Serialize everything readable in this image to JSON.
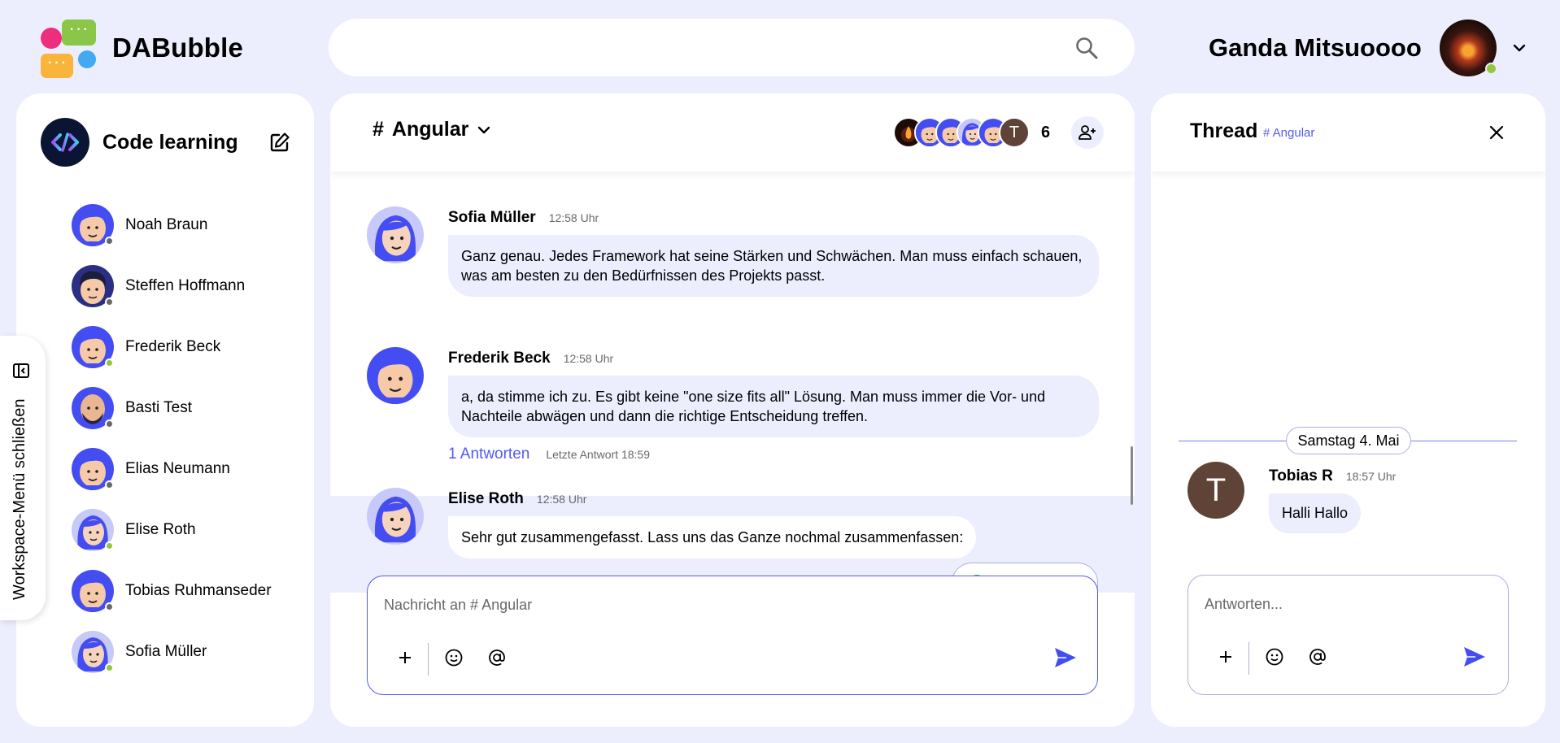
{
  "app": {
    "name": "DABubble"
  },
  "search": {
    "placeholder": ""
  },
  "user": {
    "name": "Ganda Mitsuoooo",
    "status_color": "#92c83e"
  },
  "workspace": {
    "name": "Code learning",
    "toggle_label": "Workspace-Menü schließen",
    "direct_messages": [
      {
        "name": "Noah Braun",
        "online": false
      },
      {
        "name": "Steffen Hoffmann",
        "online": false
      },
      {
        "name": "Frederik Beck",
        "online": true
      },
      {
        "name": "Basti Test",
        "online": false
      },
      {
        "name": "Elias Neumann",
        "online": false
      },
      {
        "name": "Elise Roth",
        "online": true
      },
      {
        "name": "Tobias Ruhmanseder",
        "online": false
      },
      {
        "name": "Sofia Müller",
        "online": true
      }
    ]
  },
  "channel": {
    "hash": "#",
    "name": "Angular",
    "member_count": "6",
    "member_initial": "T"
  },
  "messages": [
    {
      "author": "Sofia Müller",
      "time": "12:58 Uhr",
      "text": "Ganz genau. Jedes Framework hat seine Stärken und Schwächen. Man muss einfach schauen, was am besten zu den Bedürfnissen des Projekts passt."
    },
    {
      "author": "Frederik Beck",
      "time": "12:58 Uhr",
      "text": "a, da stimme ich zu. Es gibt keine \"one size fits all\" Lösung. Man muss immer die Vor- und Nachteile abwägen und dann die richtige Entscheidung treffen.",
      "replies": "1 Antworten",
      "last_reply": "Letzte Antwort 18:59"
    },
    {
      "author": "Elise Roth",
      "time": "12:58 Uhr",
      "text": "Sehr gut zusammengefasst. Lass uns das Ganze nochmal zusammenfassen:"
    }
  ],
  "composer": {
    "placeholder": "Nachricht an # Angular"
  },
  "thread": {
    "title": "Thread",
    "channel": "# Angular",
    "date": "Samstag 4. Mai",
    "message": {
      "initial": "T",
      "author": "Tobias R",
      "time": "18:57 Uhr",
      "text": "Halli Hallo"
    },
    "placeholder": "Antworten..."
  },
  "colors": {
    "accent": "#535af1",
    "background": "#eceefe",
    "online": "#92c83e",
    "offline": "#686868"
  }
}
